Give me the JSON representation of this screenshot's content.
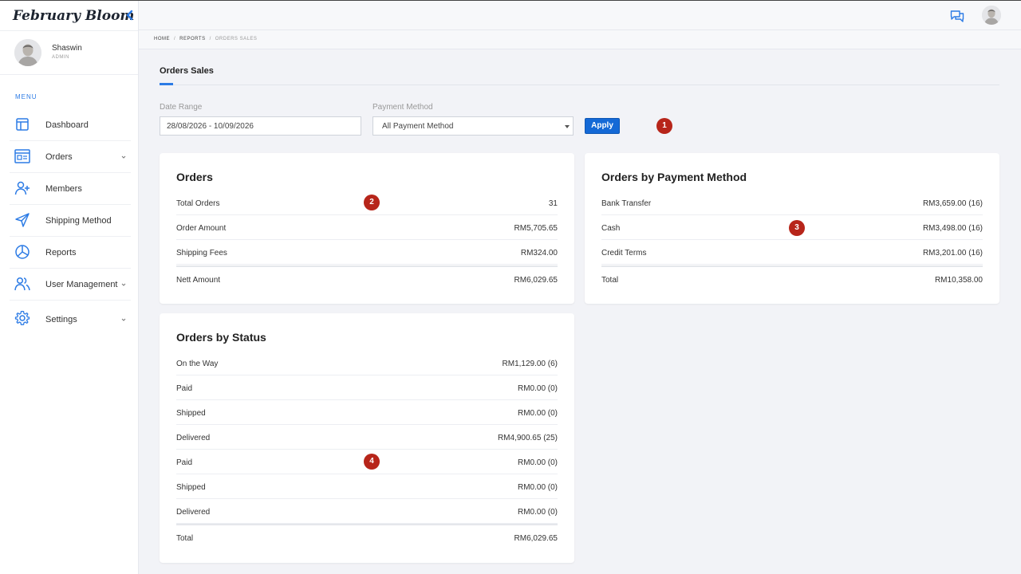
{
  "sidebar": {
    "brand": "February Bloom",
    "user": {
      "name": "Shaswin",
      "role": "ADMIN"
    },
    "menu_label": "MENU",
    "items": [
      {
        "label": "Dashboard",
        "icon": "dashboard-icon"
      },
      {
        "label": "Orders",
        "icon": "orders-icon",
        "has_children": true
      },
      {
        "label": "Members",
        "icon": "add-user-icon"
      },
      {
        "label": "Shipping Method",
        "icon": "send-icon"
      },
      {
        "label": "Reports",
        "icon": "pie-chart-icon"
      },
      {
        "label": "User Management",
        "icon": "users-icon",
        "has_children": true
      },
      {
        "label": "Settings",
        "icon": "gear-icon",
        "has_children": true
      }
    ]
  },
  "topbar": {
    "chat_icon": "chat-icon",
    "avatar": "avatar"
  },
  "breadcrumb": {
    "home": "HOME",
    "reports": "REPORTS",
    "current": "ORDERS SALES"
  },
  "tab": {
    "label": "Orders Sales"
  },
  "filters": {
    "date_range_label": "Date Range",
    "date_range_value": "28/08/2026 - 10/09/2026",
    "payment_method_label": "Payment Method",
    "payment_method_value": "All Payment Method",
    "apply_label": "Apply"
  },
  "markers": [
    "1",
    "2",
    "3",
    "4"
  ],
  "orders_card": {
    "title": "Orders",
    "rows": [
      {
        "label": "Total Orders",
        "value": "31"
      },
      {
        "label": "Order Amount",
        "value": "RM5,705.65"
      },
      {
        "label": "Shipping Fees",
        "value": "RM324.00"
      }
    ],
    "total": {
      "label": "Nett Amount",
      "value": "RM6,029.65"
    }
  },
  "payment_card": {
    "title": "Orders by Payment Method",
    "rows": [
      {
        "label": "Bank Transfer",
        "value": "RM3,659.00 (16)"
      },
      {
        "label": "Cash",
        "value": "RM3,498.00 (16)"
      },
      {
        "label": "Credit Terms",
        "value": "RM3,201.00 (16)"
      }
    ],
    "total": {
      "label": "Total",
      "value": "RM10,358.00"
    }
  },
  "status_card": {
    "title": "Orders by Status",
    "rows": [
      {
        "label": "On the Way",
        "value": "RM1,129.00 (6)"
      },
      {
        "label": "Paid",
        "value": "RM0.00 (0)"
      },
      {
        "label": "Shipped",
        "value": "RM0.00 (0)"
      },
      {
        "label": "Delivered",
        "value": "RM4,900.65 (25)"
      },
      {
        "label": "Paid",
        "value": "RM0.00 (0)"
      },
      {
        "label": "Shipped",
        "value": "RM0.00 (0)"
      },
      {
        "label": "Delivered",
        "value": "RM0.00 (0)"
      }
    ],
    "total": {
      "label": "Total",
      "value": "RM6,029.65"
    }
  },
  "colors": {
    "accent": "#2c7be5",
    "button": "#1469d6",
    "marker": "#b7251a"
  }
}
